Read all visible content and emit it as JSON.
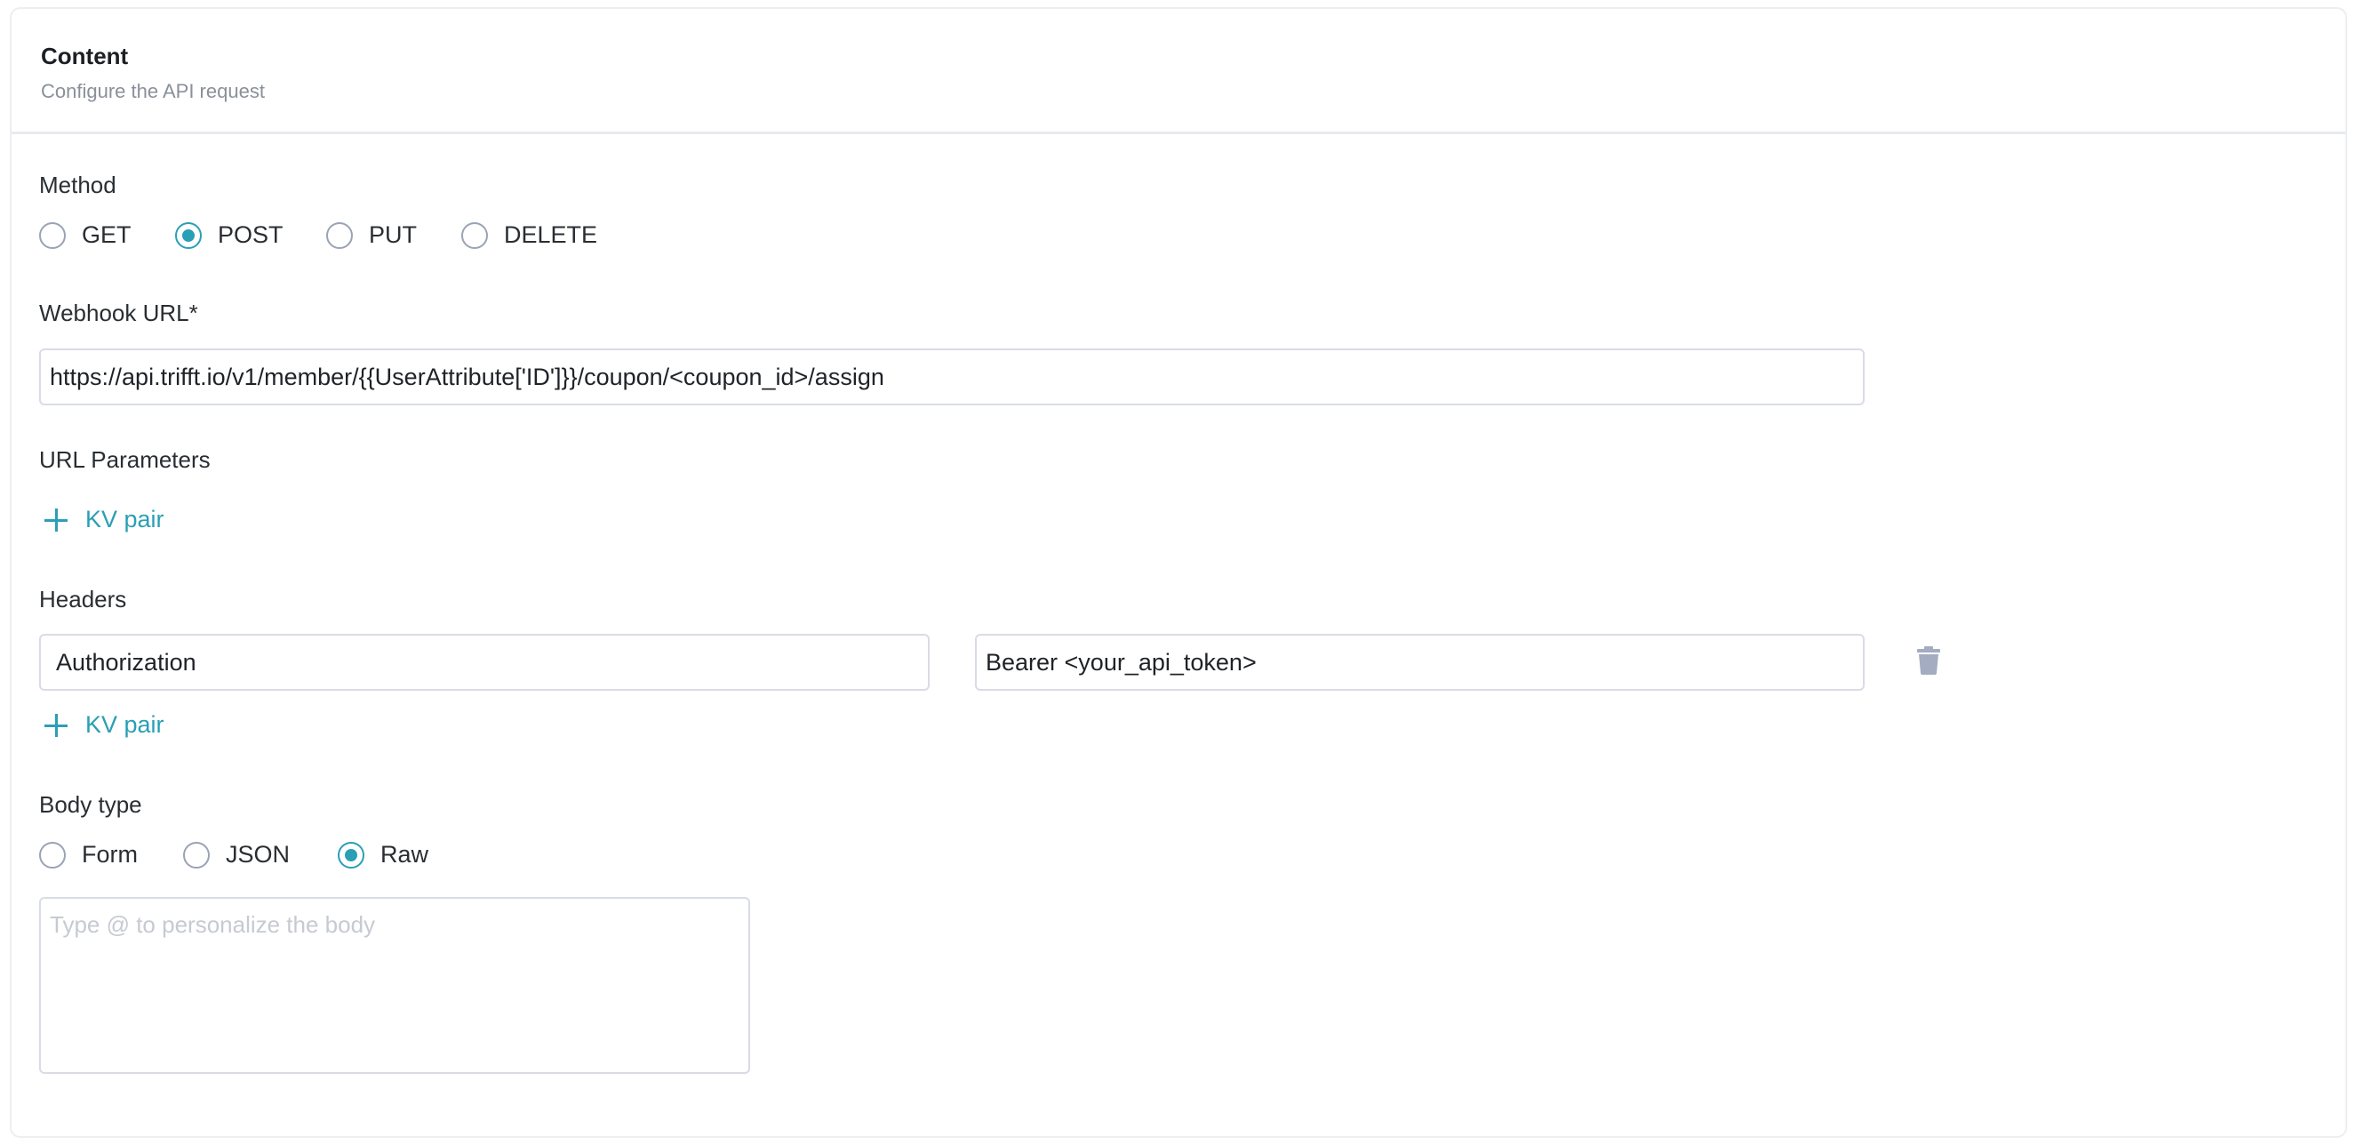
{
  "header": {
    "title": "Content",
    "subtitle": "Configure the API request"
  },
  "method": {
    "label": "Method",
    "options": [
      "GET",
      "POST",
      "PUT",
      "DELETE"
    ],
    "selected": "POST"
  },
  "webhook": {
    "label": "Webhook URL*",
    "value": "https://api.trifft.io/v1/member/{{UserAttribute['ID']}}/coupon/<coupon_id>/assign"
  },
  "url_params": {
    "label": "URL Parameters",
    "add_label": "KV pair"
  },
  "headers": {
    "label": "Headers",
    "rows": [
      {
        "key": "Authorization",
        "value": "Bearer <your_api_token>"
      }
    ],
    "add_label": "KV pair"
  },
  "body": {
    "label": "Body type",
    "options": [
      "Form",
      "JSON",
      "Raw"
    ],
    "selected": "Raw",
    "placeholder": "Type @ to personalize the body",
    "value": ""
  },
  "colors": {
    "accent": "#2a9fb5",
    "border": "#d9dce6",
    "trash_icon": "#a3acc0"
  },
  "icons": [
    "plus-icon",
    "trash-icon"
  ]
}
